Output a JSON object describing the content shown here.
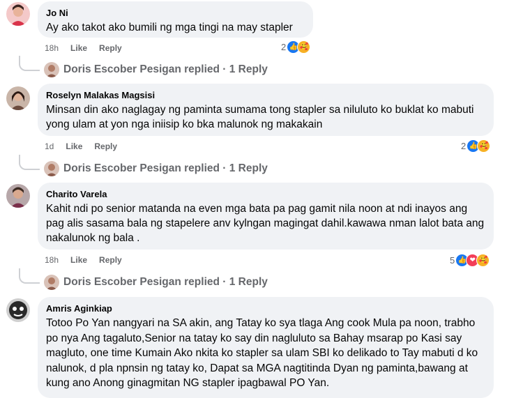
{
  "comments": [
    {
      "author": "Jo Ni",
      "text": "Ay ako takot ako bumili ng mga tingi na may stapler",
      "time": "18h",
      "like": "Like",
      "reply": "Reply",
      "reaction_count": "2",
      "reactions": [
        "like-icon",
        "care-icon"
      ],
      "replied_line": "Doris Escober Pesigan replied · 1 Reply"
    },
    {
      "author": "Roselyn Malakas Magsisi",
      "text": "Minsan din ako naglagay ng paminta sumama tong stapler sa niluluto ko buklat ko mabuti yong ulam at yon nga iniisip ko bka malunok ng makakain",
      "time": "1d",
      "like": "Like",
      "reply": "Reply",
      "reaction_count": "2",
      "reactions": [
        "like-icon",
        "care-icon"
      ],
      "replied_line": "Doris Escober Pesigan replied · 1 Reply"
    },
    {
      "author": "Charito Varela",
      "text": "Kahit ndi po senior matanda na even mga bata pa pag gamit nila noon at ndi inayos ang pag alis sasama bala ng stapelere anv kylngan magingat dahil.kawawa nman lalot bata ang nakalunok ng bala .",
      "time": "18h",
      "like": "Like",
      "reply": "Reply",
      "reaction_count": "5",
      "reactions": [
        "like-icon",
        "heart-icon",
        "care-icon"
      ],
      "replied_line": "Doris Escober Pesigan replied · 1 Reply"
    },
    {
      "author": "Amris Aginkiap",
      "text": "Totoo Po Yan nangyari na SA akin, ang Tatay ko sya tlaga Ang cook Mula pa noon, trabho po nya Ang tagaluto,Senior na tatay ko say din nagluluto sa Bahay msarap po Kasi say magluto, one time Kumain Ako nkita ko stapler sa ulam SBI ko delikado to Tay mabuti d ko nalunok, d pla npnsin ng tatay ko, Dapat sa MGA nagtitinda Dyan ng paminta,bawang at kung ano Anong ginagmitan NG stapler ipagbawal PO Yan."
    }
  ],
  "colors": {
    "bubble": "#f0f2f5",
    "meta": "#65676b",
    "like_blue": "#1877f2",
    "heart_red": "#f33e58",
    "care_yellow": "#f7b125"
  }
}
